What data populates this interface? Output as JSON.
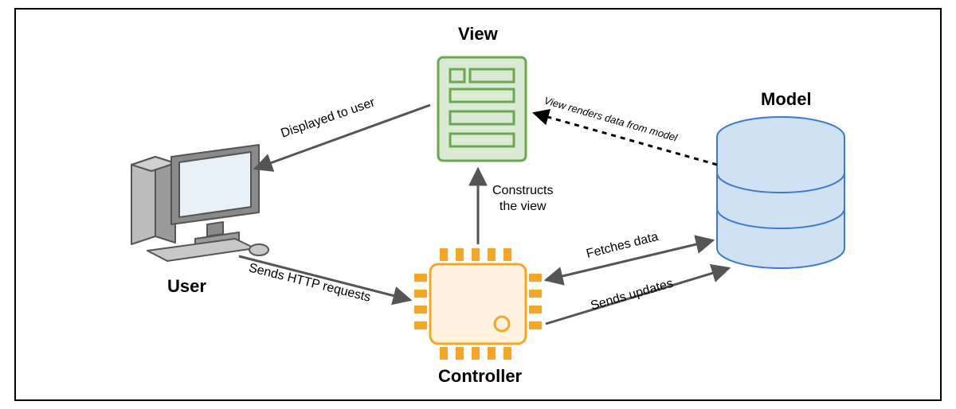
{
  "nodes": {
    "view": {
      "label": "View"
    },
    "model": {
      "label": "Model"
    },
    "user": {
      "label": "User"
    },
    "controller": {
      "label": "Controller"
    }
  },
  "edges": {
    "view_to_user": {
      "label": "Displayed to user"
    },
    "controller_to_view": {
      "label": "Constructs\nthe view"
    },
    "model_to_view": {
      "label": "View renders data from model"
    },
    "user_to_controller": {
      "label": "Sends HTTP requests"
    },
    "controller_model_fetch": {
      "label": "Fetches data"
    },
    "controller_model_update": {
      "label": "Sends updates"
    }
  }
}
